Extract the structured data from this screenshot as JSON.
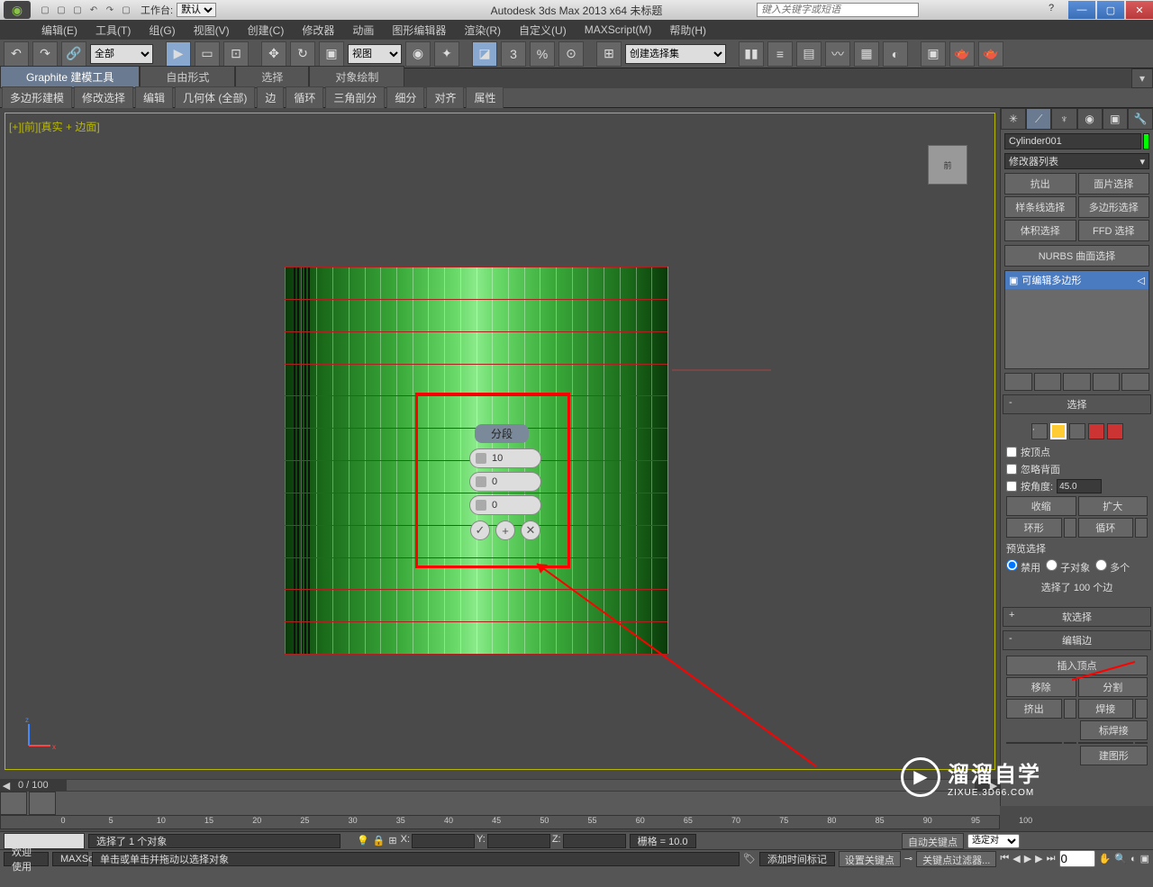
{
  "titlebar": {
    "workspace_label": "工作台:",
    "workspace_value": "默认",
    "app_title": "Autodesk 3ds Max  2013 x64   未标题",
    "search_placeholder": "键入关键字或短语"
  },
  "menubar": [
    "编辑(E)",
    "工具(T)",
    "组(G)",
    "视图(V)",
    "创建(C)",
    "修改器",
    "动画",
    "图形编辑器",
    "渲染(R)",
    "自定义(U)",
    "MAXScript(M)",
    "帮助(H)"
  ],
  "toolbar": {
    "filter1": "全部",
    "filter2": "视图",
    "selset": "创建选择集"
  },
  "ribbon": {
    "tabs": [
      "Graphite 建模工具",
      "自由形式",
      "选择",
      "对象绘制"
    ],
    "groups": [
      "多边形建模",
      "修改选择",
      "编辑",
      "几何体 (全部)",
      "边",
      "循环",
      "三角剖分",
      "细分",
      "对齐",
      "属性"
    ]
  },
  "viewport": {
    "label": "[+][前][真实 + 边面]",
    "viewcube": "前",
    "frame_info": "0 / 100"
  },
  "caddy": {
    "title": "分段",
    "field1": "10",
    "field2": "0",
    "field3": "0"
  },
  "right_panel": {
    "object_name": "Cylinder001",
    "modifier_list": "修改器列表",
    "buttons": [
      "抗出",
      "面片选择",
      "样条线选择",
      "多边形选择",
      "体积选择",
      "FFD 选择"
    ],
    "nurbs": "NURBS 曲面选择",
    "stack_item": "可编辑多边形",
    "rollout_select": {
      "title": "选择",
      "by_vertex": "按顶点",
      "ignore_backface": "忽略背面",
      "by_angle": "按角度:",
      "angle_value": "45.0",
      "shrink": "收缩",
      "grow": "扩大",
      "ring": "环形",
      "loop": "循环",
      "preview_label": "预览选择",
      "radio": [
        "禁用",
        "子对象",
        "多个"
      ],
      "sel_count": "选择了 100 个边"
    },
    "rollout_soft": "软选择",
    "rollout_edit": {
      "title": "编辑边",
      "insert_vertex": "插入顶点",
      "remove": "移除",
      "split": "分割",
      "extrude": "挤出",
      "weld": "焊接",
      "target_weld": "标焊接",
      "shape_from": "建图形"
    }
  },
  "status": {
    "selected": "选择了 1 个对象",
    "prompt": "单击或单击并拖动以选择对象",
    "welcome": "欢迎使用",
    "maxsc": "MAXSc",
    "x_label": "X:",
    "y_label": "Y:",
    "z_label": "Z:",
    "grid": "栅格 = 10.0",
    "add_time_tag": "添加时间标记",
    "auto_key": "自动关键点",
    "set_key": "设置关键点",
    "selected_obj": "选定对",
    "key_filter": "关键点过滤器...",
    "spin_val": "0"
  },
  "timeline_ticks": [
    0,
    5,
    10,
    15,
    20,
    25,
    30,
    35,
    40,
    45,
    50,
    55,
    60,
    65,
    70,
    75,
    80,
    85,
    90,
    95,
    100
  ],
  "watermark": {
    "big": "溜溜自学",
    "small": "ZIXUE.3D66.COM"
  }
}
